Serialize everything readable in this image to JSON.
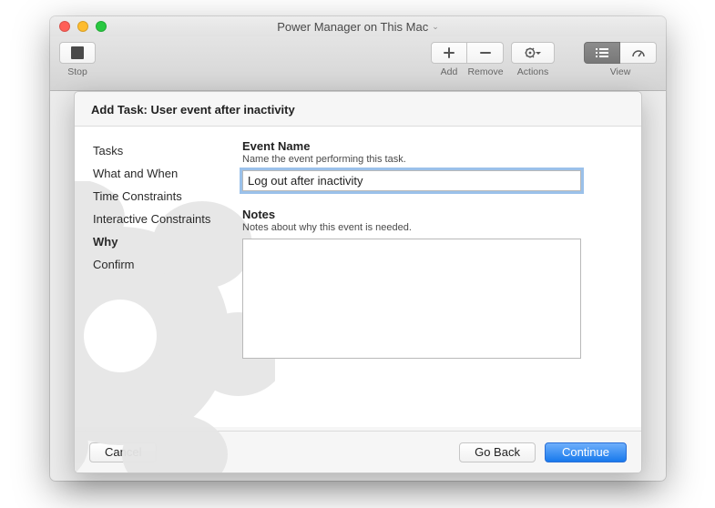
{
  "window": {
    "title": "Power Manager on This Mac"
  },
  "toolbar": {
    "stop": "Stop",
    "add": "Add",
    "remove": "Remove",
    "actions": "Actions",
    "view": "View"
  },
  "sheet": {
    "title": "Add Task: User event after inactivity"
  },
  "nav": {
    "items": [
      {
        "label": "Tasks"
      },
      {
        "label": "What and When"
      },
      {
        "label": "Time Constraints"
      },
      {
        "label": "Interactive Constraints"
      },
      {
        "label": "Why",
        "current": true
      },
      {
        "label": "Confirm"
      }
    ]
  },
  "form": {
    "event_name_label": "Event Name",
    "event_name_help": "Name the event performing this task.",
    "event_name_value": "Log out after inactivity",
    "notes_label": "Notes",
    "notes_help": "Notes about why this event is needed.",
    "notes_value": ""
  },
  "buttons": {
    "cancel": "Cancel",
    "go_back": "Go Back",
    "continue": "Continue"
  }
}
